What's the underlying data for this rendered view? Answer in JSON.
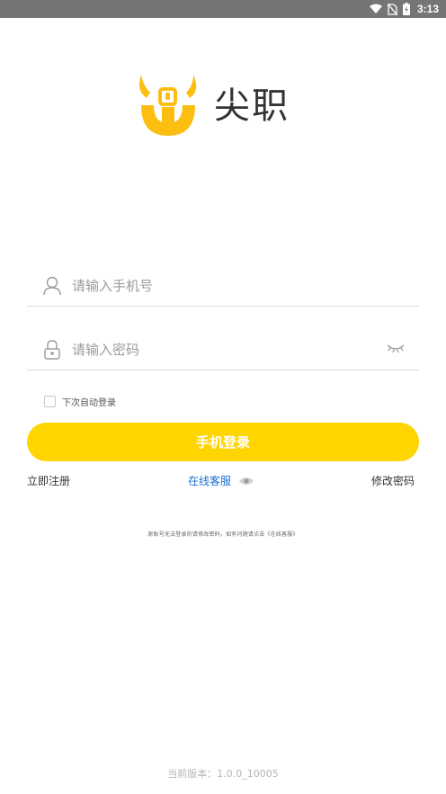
{
  "status_bar": {
    "time": "3:13"
  },
  "brand": {
    "name": "尖职",
    "yellow": "#FDBE12"
  },
  "form": {
    "phone_placeholder": "请输入手机号",
    "password_placeholder": "请输入密码",
    "remember_label": "下次自动登录",
    "login_button": "手机登录"
  },
  "links": {
    "register": "立即注册",
    "service": "在线客服",
    "reset": "修改密码"
  },
  "notice": "原账号无法登录的请修改密码，如有问题请点击《在线客服》",
  "version": "当前版本：1.0.0_10005",
  "colors": {
    "button": "#FFD500",
    "link": "#1A6FD1"
  }
}
